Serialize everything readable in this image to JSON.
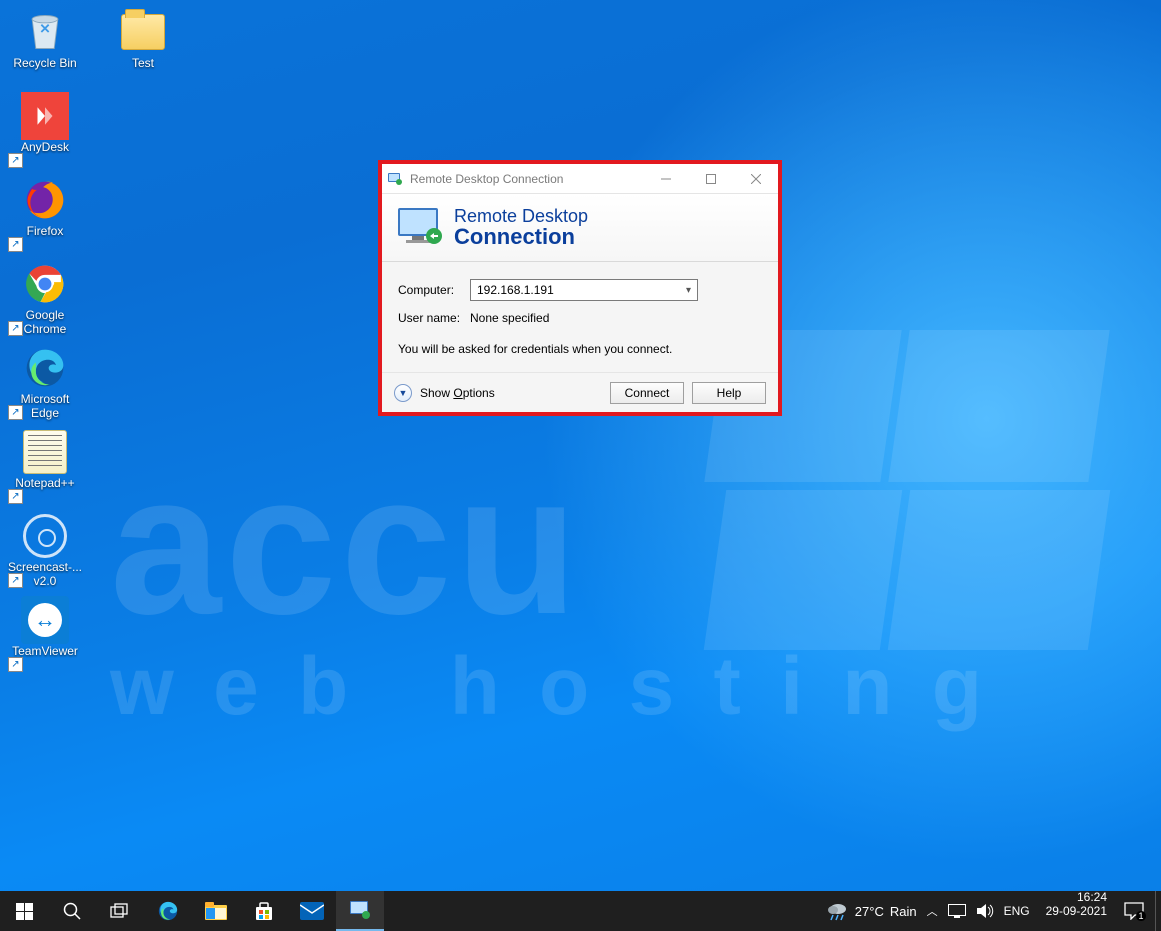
{
  "desktop_icons": {
    "recycle_bin": "Recycle Bin",
    "test": "Test",
    "anydesk": "AnyDesk",
    "firefox": "Firefox",
    "chrome": "Google Chrome",
    "edge": "Microsoft Edge",
    "notepadpp": "Notepad++",
    "screencast": "Screencast-... v2.0",
    "teamviewer": "TeamViewer"
  },
  "watermark": {
    "line1": "accu",
    "line2": "web hosting"
  },
  "rdp": {
    "title": "Remote Desktop Connection",
    "heading1": "Remote Desktop",
    "heading2": "Connection",
    "computer_label": "Computer:",
    "computer_value": "192.168.1.191",
    "username_label": "User name:",
    "username_value": "None specified",
    "hint": "You will be asked for credentials when you connect.",
    "show_options_pre": "Show ",
    "show_options_u": "O",
    "show_options_post": "ptions",
    "connect": "Connect",
    "help": "Help"
  },
  "taskbar": {
    "weather_temp": "27°C",
    "weather_cond": "Rain",
    "lang": "ENG",
    "time": "16:24",
    "date": "29-09-2021",
    "notif_count": "1"
  }
}
